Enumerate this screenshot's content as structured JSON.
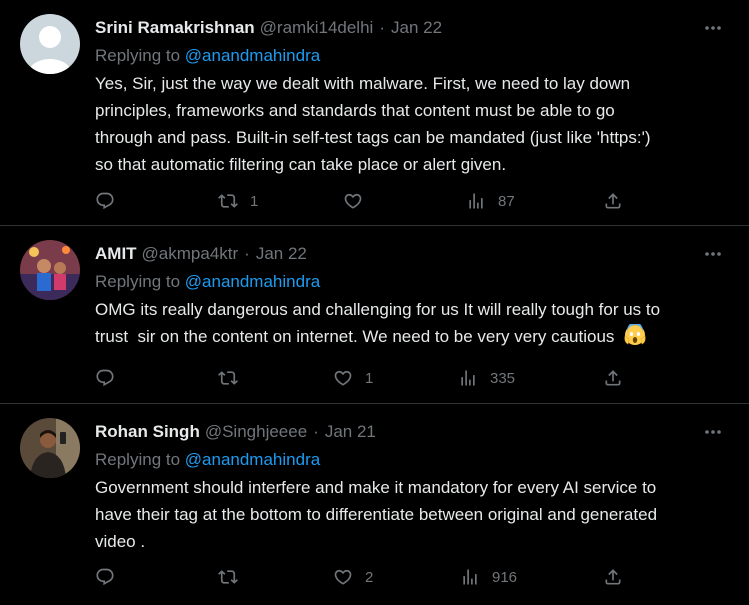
{
  "tweets": [
    {
      "name": "Srini Ramakrishnan",
      "handle": "@ramki14delhi",
      "date": "Jan 22",
      "replying_prefix": "Replying to ",
      "replying_to": "@anandmahindra",
      "text": "Yes, Sir, just the way we dealt with malware. First, we need to lay down\nprinciples, frameworks and standards that content must be able to go\nthrough and pass. Built-in self-test tags can be mandated (just like 'https:')\nso that automatic filtering can take place or alert given.",
      "replies": "",
      "retweets": "1",
      "likes": "",
      "views": "87"
    },
    {
      "name": "AMIT",
      "handle": "@akmpa4ktr",
      "date": "Jan 22",
      "replying_prefix": "Replying to ",
      "replying_to": "@anandmahindra",
      "text": "OMG its really dangerous and challenging for us It will really tough for us to\ntrust  sir on the content on internet. We need to be very very cautious",
      "replies": "",
      "retweets": "",
      "likes": "1",
      "views": "335"
    },
    {
      "name": "Rohan Singh",
      "handle": "@Singhjeeee",
      "date": "Jan 21",
      "replying_prefix": "Replying to ",
      "replying_to": "@anandmahindra",
      "text": "Government should interfere and make it mandatory for every AI service to\nhave their tag at the bottom to differentiate between original and generated\nvideo .",
      "replies": "",
      "retweets": "",
      "likes": "2",
      "views": "916"
    }
  ],
  "colors": {
    "background": "#000000",
    "text": "#e7e9ea",
    "muted": "#71767b",
    "link": "#1d9bf0",
    "divider": "#2f3336"
  },
  "icons": [
    "more-icon",
    "reply-icon",
    "retweet-icon",
    "like-icon",
    "views-icon",
    "share-icon",
    "screaming-face-emoji"
  ]
}
